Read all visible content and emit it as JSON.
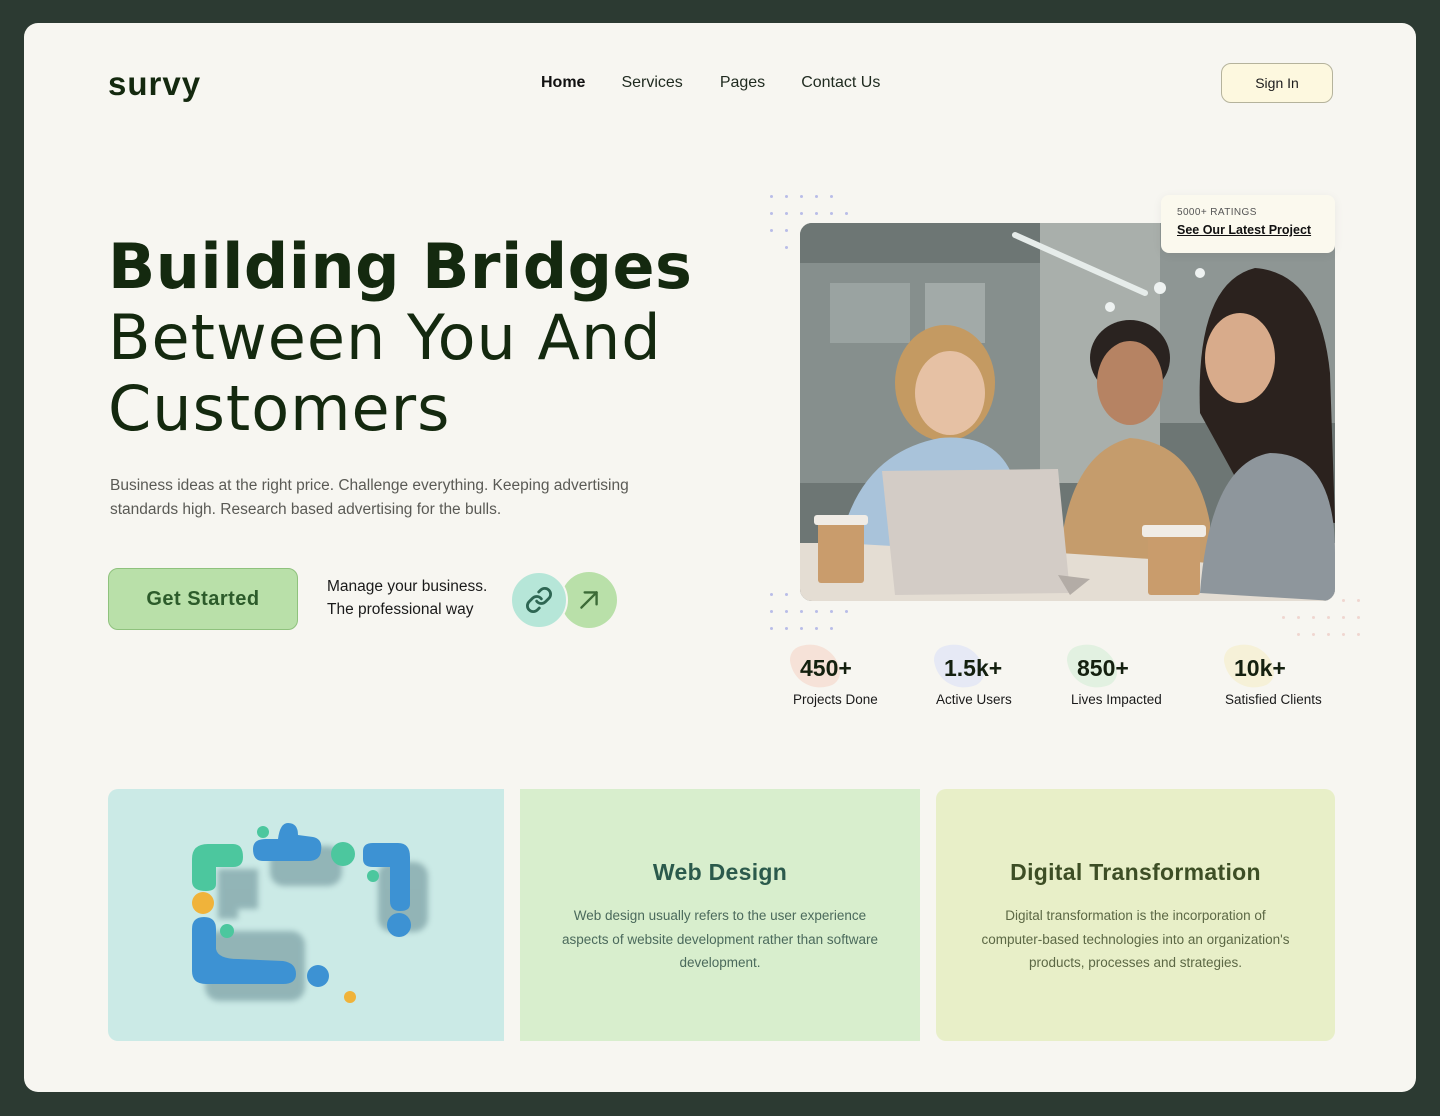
{
  "header": {
    "logo": "survy",
    "nav": [
      {
        "label": "Home",
        "active": true
      },
      {
        "label": "Services",
        "active": false
      },
      {
        "label": "Pages",
        "active": false
      },
      {
        "label": "Contact Us",
        "active": false
      }
    ],
    "sign_in_label": "Sign In"
  },
  "hero": {
    "title_line1": "Building Bridges",
    "title_line2": "Between You And",
    "title_line3": "Customers",
    "description": "Business ideas at the right price. Challenge everything. Keeping advertising standards high. Research based advertising for the bulls.",
    "cta_label": "Get Started",
    "tagline_line1": "Manage your business.",
    "tagline_line2": "The professional way",
    "icons": [
      "link-icon",
      "arrow-up-right-icon"
    ]
  },
  "rating_card": {
    "small_label": "5000+ RATINGS",
    "link_label": "See Our Latest Project"
  },
  "stats": [
    {
      "value": "450+",
      "label": "Projects Done",
      "accent": "#f6d2c2"
    },
    {
      "value": "1.5k+",
      "label": "Active Users",
      "accent": "#d9def7"
    },
    {
      "value": "850+",
      "label": "Lives Impacted",
      "accent": "#d2ecd3"
    },
    {
      "value": "10k+",
      "label": "Satisfied Clients",
      "accent": "#f6ecc2"
    }
  ],
  "services": [
    {
      "title": "Web Design",
      "description": "Web design usually refers to the user experience aspects of website development rather than software development."
    },
    {
      "title": "Digital Transformation",
      "description": "Digital transformation is the incorporation of computer-based technologies into an organization's products, processes and strategies."
    }
  ],
  "colors": {
    "background_frame": "#2c3a32",
    "page": "#f7f6f1",
    "brand_dark": "#14290f",
    "cta_green": "#b9e0a9",
    "card_teal": "#cbeae6",
    "card_green": "#d8eecd",
    "card_lime": "#e8efc8"
  }
}
